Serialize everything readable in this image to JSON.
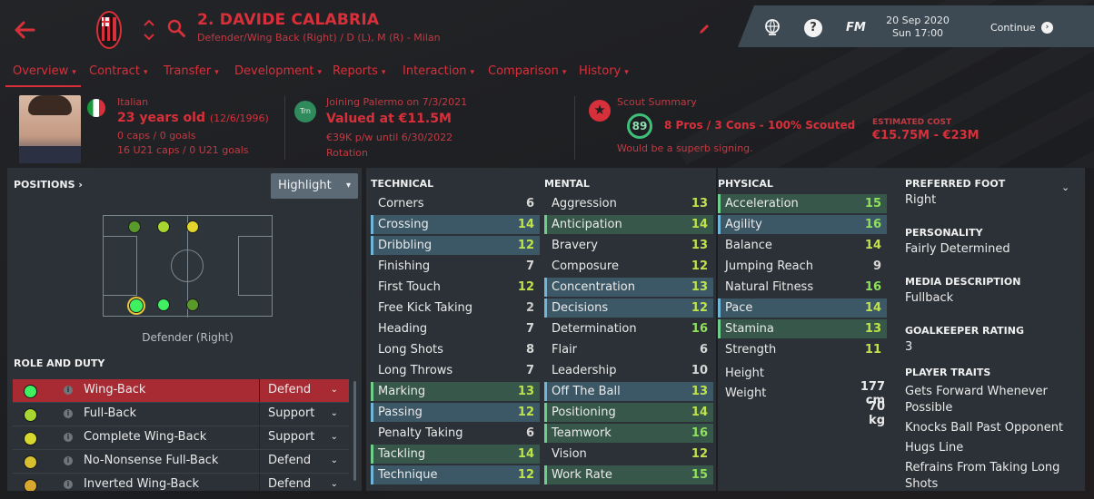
{
  "header": {
    "player_name": "2. DAVIDE CALABRIA",
    "player_sub": "Defender/Wing Back (Right) / D (L), M (R) - Milan",
    "date": "20 Sep 2020",
    "time": "Sun 17:00",
    "continue_label": "Continue",
    "fm_label": "FM",
    "help_label": "?"
  },
  "tabs": [
    {
      "label": "Overview"
    },
    {
      "label": "Contract"
    },
    {
      "label": "Transfer"
    },
    {
      "label": "Development"
    },
    {
      "label": "Reports"
    },
    {
      "label": "Interaction"
    },
    {
      "label": "Comparison"
    },
    {
      "label": "History"
    }
  ],
  "info": {
    "nationality": "Italian",
    "age": "23 years old",
    "dob": "(12/6/1996)",
    "caps": "0 caps / 0 goals",
    "u21_caps": "16 U21 caps / 0 U21 goals",
    "joining": "Joining Palermo on 7/3/2021",
    "club_badge": "Trn",
    "value": "Valued at €11.5M",
    "wage": "€39K p/w until 6/30/2022",
    "status": "Rotation",
    "scout_label": "Scout Summary",
    "scout_score": "89",
    "scout_summary": "8 Pros / 3 Cons - 100% Scouted",
    "scout_comment": "Would be a superb signing.",
    "est_cost_label": "ESTIMATED COST",
    "est_cost": "€15.75M - €23M"
  },
  "positions": {
    "title": "POSITIONS ›",
    "highlight_label": "Highlight",
    "position_label": "Defender (Right)"
  },
  "roles": {
    "title": "ROLE AND DUTY",
    "items": [
      {
        "name": "Wing-Back",
        "duty": "Defend",
        "rating_color": "#3ff060"
      },
      {
        "name": "Full-Back",
        "duty": "Support",
        "rating_color": "#a8d630"
      },
      {
        "name": "Complete Wing-Back",
        "duty": "Support",
        "rating_color": "#d6d82e"
      },
      {
        "name": "No-Nonsense Full-Back",
        "duty": "Defend",
        "rating_color": "#d6c02e"
      },
      {
        "name": "Inverted Wing-Back",
        "duty": "Defend",
        "rating_color": "#d6a82e"
      }
    ]
  },
  "technical": {
    "title": "TECHNICAL",
    "rows": [
      {
        "name": "Corners",
        "value": "6",
        "hl": ""
      },
      {
        "name": "Crossing",
        "value": "14",
        "hl": "b"
      },
      {
        "name": "Dribbling",
        "value": "12",
        "hl": "b"
      },
      {
        "name": "Finishing",
        "value": "7",
        "hl": ""
      },
      {
        "name": "First Touch",
        "value": "12",
        "hl": ""
      },
      {
        "name": "Free Kick Taking",
        "value": "2",
        "hl": ""
      },
      {
        "name": "Heading",
        "value": "7",
        "hl": ""
      },
      {
        "name": "Long Shots",
        "value": "8",
        "hl": ""
      },
      {
        "name": "Long Throws",
        "value": "7",
        "hl": ""
      },
      {
        "name": "Marking",
        "value": "13",
        "hl": "g"
      },
      {
        "name": "Passing",
        "value": "12",
        "hl": "b"
      },
      {
        "name": "Penalty Taking",
        "value": "6",
        "hl": ""
      },
      {
        "name": "Tackling",
        "value": "14",
        "hl": "g"
      },
      {
        "name": "Technique",
        "value": "12",
        "hl": "b"
      }
    ]
  },
  "mental": {
    "title": "MENTAL",
    "rows": [
      {
        "name": "Aggression",
        "value": "13",
        "hl": ""
      },
      {
        "name": "Anticipation",
        "value": "14",
        "hl": "g"
      },
      {
        "name": "Bravery",
        "value": "13",
        "hl": ""
      },
      {
        "name": "Composure",
        "value": "12",
        "hl": ""
      },
      {
        "name": "Concentration",
        "value": "13",
        "hl": "b"
      },
      {
        "name": "Decisions",
        "value": "12",
        "hl": "b"
      },
      {
        "name": "Determination",
        "value": "16",
        "hl": ""
      },
      {
        "name": "Flair",
        "value": "6",
        "hl": ""
      },
      {
        "name": "Leadership",
        "value": "10",
        "hl": ""
      },
      {
        "name": "Off The Ball",
        "value": "13",
        "hl": "b"
      },
      {
        "name": "Positioning",
        "value": "14",
        "hl": "g"
      },
      {
        "name": "Teamwork",
        "value": "16",
        "hl": "g"
      },
      {
        "name": "Vision",
        "value": "12",
        "hl": ""
      },
      {
        "name": "Work Rate",
        "value": "15",
        "hl": "g"
      }
    ]
  },
  "physical": {
    "title": "PHYSICAL",
    "rows": [
      {
        "name": "Acceleration",
        "value": "15",
        "hl": "g"
      },
      {
        "name": "Agility",
        "value": "16",
        "hl": "b"
      },
      {
        "name": "Balance",
        "value": "14",
        "hl": ""
      },
      {
        "name": "Jumping Reach",
        "value": "9",
        "hl": ""
      },
      {
        "name": "Natural Fitness",
        "value": "16",
        "hl": ""
      },
      {
        "name": "Pace",
        "value": "14",
        "hl": "b"
      },
      {
        "name": "Stamina",
        "value": "13",
        "hl": "g"
      },
      {
        "name": "Strength",
        "value": "11",
        "hl": ""
      }
    ],
    "height_label": "Height",
    "height": "177 cm",
    "weight_label": "Weight",
    "weight": "70 kg"
  },
  "details": {
    "foot_label": "PREFERRED FOOT",
    "foot": "Right",
    "personality_label": "PERSONALITY",
    "personality": "Fairly Determined",
    "media_label": "MEDIA DESCRIPTION",
    "media": "Fullback",
    "gk_label": "GOALKEEPER RATING",
    "gk": "3",
    "traits_label": "PLAYER TRAITS",
    "traits": [
      "Gets Forward Whenever Possible",
      "Knocks Ball Past Opponent",
      "Hugs Line",
      "Refrains From Taking Long Shots"
    ]
  },
  "colors": {
    "accent": "#d8303a",
    "panel": "#2b3136",
    "highlight_blue": "#3c5766",
    "highlight_green": "#37574a"
  }
}
